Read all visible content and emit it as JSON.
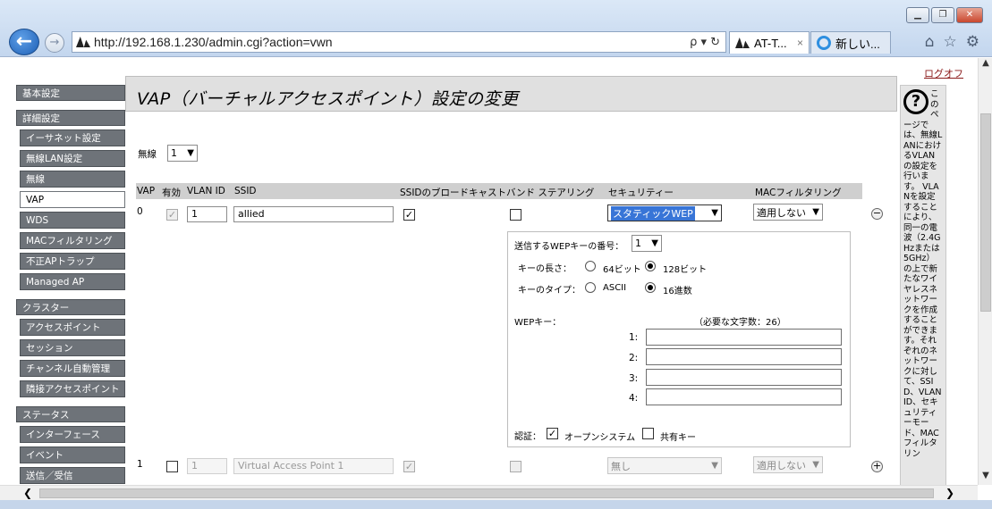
{
  "browser": {
    "url": "http://192.168.1.230/admin.cgi?action=vwn",
    "search_symbols": "ρ ▾ ↻",
    "tabs": [
      {
        "title": "AT-T...",
        "close": "×"
      },
      {
        "title": "新しい..."
      }
    ]
  },
  "page": {
    "logout": "ログオフ",
    "title": "VAP（バーチャルアクセスポイント）設定の変更",
    "radio_label": "無線",
    "radio_value": "1"
  },
  "sidebar": {
    "sections": [
      {
        "head": "基本設定",
        "items": []
      },
      {
        "head": "詳細設定",
        "items": [
          "イーサネット設定",
          "無線LAN設定",
          "無線",
          "VAP",
          "WDS",
          "MACフィルタリング",
          "不正APトラップ",
          "Managed AP"
        ]
      },
      {
        "head": "クラスター",
        "items": [
          "アクセスポイント",
          "セッション",
          "チャンネル自動管理",
          "隣接アクセスポイント"
        ]
      },
      {
        "head": "ステータス",
        "items": [
          "インターフェース",
          "イベント",
          "送信／受信"
        ]
      }
    ],
    "active_item": "VAP"
  },
  "table": {
    "headers": [
      "VAP",
      "有効",
      "VLAN ID",
      "SSID",
      "SSIDのブロードキャスト",
      "バンド ステアリング",
      "セキュリティー",
      "MACフィルタリング"
    ],
    "rows": [
      {
        "vap": "0",
        "vlan_id": "1",
        "ssid": "allied",
        "security": "スタティックWEP",
        "mac_filter": "適用しない"
      },
      {
        "vap": "1",
        "vlan_id": "1",
        "ssid": "Virtual Access Point 1",
        "security": "無し",
        "mac_filter": "適用しない"
      }
    ]
  },
  "wep": {
    "key_number_label": "送信するWEPキーの番号：",
    "key_number_value": "1",
    "key_length_label": "キーの長さ：",
    "key_length_opt1": "64ビット",
    "key_length_opt2": "128ビット",
    "key_type_label": "キーのタイプ：",
    "key_type_opt1": "ASCII",
    "key_type_opt2": "16進数",
    "wep_key_label": "WEPキー：",
    "required_chars": "（必要な文字数：26）",
    "key_labels": [
      "1:",
      "2:",
      "3:",
      "4:"
    ],
    "auth_label": "認証：",
    "auth_open": "オープンシステム",
    "auth_shared": "共有キー"
  },
  "help": {
    "text": "このページでは、無線LANにおけるVLANの設定を行います。 VLANを設定することにより、同一の電波（2.4GHzまたは5GHz）の上で新たなワイヤレスネットワークを作成することができます。それぞれのネットワークに対して、SSID、VLAN ID、セキュリティーモード、MACフィルタリン"
  }
}
